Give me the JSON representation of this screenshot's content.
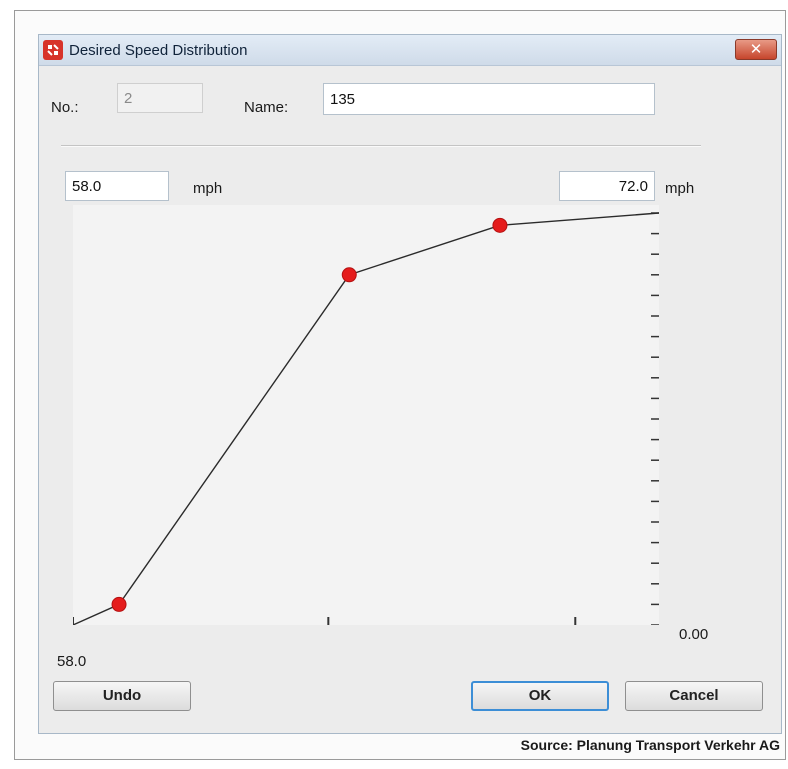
{
  "window": {
    "title": "Desired Speed Distribution",
    "close_label": "✕"
  },
  "form": {
    "number_label": "No.:",
    "number_value": "2",
    "name_label": "Name:",
    "name_value": "135"
  },
  "speed_range": {
    "min_value": "58.0",
    "max_value": "72.0",
    "unit": "mph",
    "axis_start_label": "58.0",
    "y_axis_label": "0.00"
  },
  "chart_data": {
    "type": "line",
    "title": "",
    "xlabel": "",
    "ylabel": "",
    "xlim": [
      58.0,
      72.0
    ],
    "ylim": [
      0.0,
      1.0
    ],
    "grid": false,
    "x": [
      58.0,
      59.1,
      64.6,
      68.2,
      72.0
    ],
    "y": [
      0.0,
      0.05,
      0.85,
      0.97,
      1.0
    ],
    "control_points": [
      {
        "x": 59.1,
        "y": 0.05
      },
      {
        "x": 64.6,
        "y": 0.85
      },
      {
        "x": 68.2,
        "y": 0.97
      }
    ],
    "x_ticks": [
      58.0,
      64.1,
      70.0
    ],
    "y_tick_count": 21,
    "y_tick_label": "0.00",
    "colors": {
      "line": "#2b2b2b",
      "point": "#e51c1c"
    }
  },
  "buttons": {
    "undo": "Undo",
    "ok": "OK",
    "cancel": "Cancel"
  },
  "source_text": "Source: Planung Transport Verkehr AG"
}
